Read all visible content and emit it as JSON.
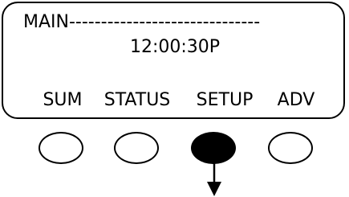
{
  "display": {
    "screen_title": "MAIN------------------------------",
    "time": "12:00:30P"
  },
  "softkeys": [
    {
      "label": "SUM"
    },
    {
      "label": "STATUS"
    },
    {
      "label": "SETUP",
      "selected": true
    },
    {
      "label": "ADV"
    }
  ],
  "colors": {
    "foreground": "#000000",
    "background": "#ffffff"
  },
  "icons": {
    "press_indicator": "arrow-down-icon"
  }
}
